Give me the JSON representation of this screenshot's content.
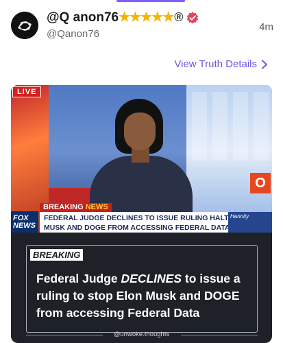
{
  "post": {
    "display_name": "@Q anon76",
    "name_decoration": "★★★★★",
    "registered_mark": "®",
    "handle": "@Qanon76",
    "timestamp": "4m",
    "details_link": "View Truth Details"
  },
  "media": {
    "live_badge": "LIVE",
    "ticker": {
      "logo_line1": "FOX",
      "logo_line2": "NEWS",
      "tag_part1": "BREAKING ",
      "tag_part2": "NEWS",
      "line1": "FEDERAL JUDGE DECLINES TO ISSUE RULING HALTING",
      "line2": "MUSK AND DOGE FROM ACCESSING FEDERAL DATA",
      "show_name": "Hannity"
    },
    "corner_letter": "O",
    "caption_tag": "BREAKING",
    "headline_part1": "Federal Judge ",
    "headline_emphasis": "DECLINES",
    "headline_part2": " to issue a ruling to stop Elon Musk and DOGE from accessing Federal Data",
    "watermark": "@unwoke.thoughts"
  },
  "colors": {
    "accent": "#6a57e8",
    "stars": "#f5b400",
    "verified_badge": "#e8435a",
    "fox_red": "#c4201d"
  },
  "icons": {
    "verified": "verified-badge-icon",
    "chevron": "chevron-right-icon"
  }
}
